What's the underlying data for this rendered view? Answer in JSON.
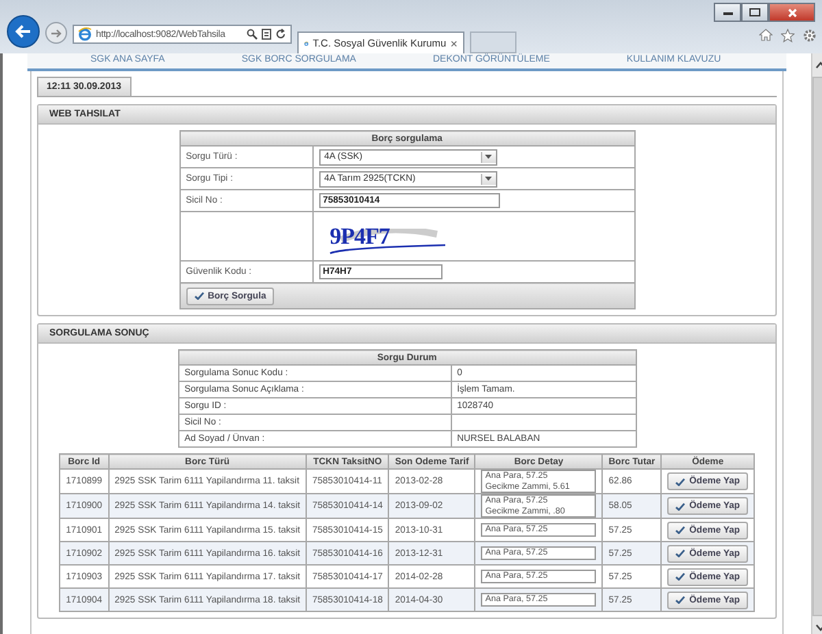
{
  "browser": {
    "address": "http://localhost:9082/WebTahsila",
    "tab_title": "T.C. Sosyal Güvenlik Kurumu",
    "tab_close": "×"
  },
  "nav": [
    "SGK ANA SAYFA",
    "SGK BORC SORGULAMA",
    "DEKONT GÖRÜNTÜLEME",
    "KULLANIM KLAVUZU"
  ],
  "datetime": "12:11 30.09.2013",
  "web_tahsilat": {
    "title": "WEB TAHSILAT",
    "form_title": "Borç sorgulama",
    "button": "Borç Sorgula",
    "fields": [
      {
        "kind": "select",
        "label": "Sorgu Türü :",
        "value": "4A (SSK)"
      },
      {
        "kind": "select",
        "label": "Sorgu Tipi :",
        "value": "4A Tarım 2925(TCKN)"
      },
      {
        "kind": "input",
        "label": "Sicil No :",
        "value": "75853010414"
      },
      {
        "kind": "captcha",
        "captcha_text": "9P4F7"
      },
      {
        "kind": "input",
        "label": "Güvenlik Kodu :",
        "value": "H74H7"
      }
    ]
  },
  "result": {
    "title": "SORGULAMA SONUÇ",
    "status_title": "Sorgu Durum",
    "status": [
      {
        "label": "Sorgulama Sonuc Kodu :",
        "value": "0"
      },
      {
        "label": "Sorgulama Sonuc Açıklama :",
        "value": "İşlem Tamam."
      },
      {
        "label": "Sorgu ID :",
        "value": "1028740"
      },
      {
        "label": "Sicil No :"
      },
      {
        "label": "Ad Soyad / Ünvan :",
        "value": "NURSEL BALABAN"
      }
    ],
    "table": {
      "columns": [
        "Borc Id",
        "Borc Türü",
        "TCKN TaksitNO",
        "Son Odeme Tarif",
        "Borc Detay",
        "Borc Tutar",
        "Ödeme"
      ],
      "rows": [
        {
          "id": "1710899",
          "type": "2925 SSK Tarim 6111 Yapilandırma 11. taksit",
          "tckn": "75853010414-11",
          "due": "2013-02-28",
          "detail": [
            "Ana Para, 57.25",
            "Gecikme Zammi, 5.61"
          ],
          "amount": "62.86",
          "button": "Ödeme Yap"
        },
        {
          "id": "1710900",
          "type": "2925 SSK Tarim 6111 Yapilandırma 14. taksit",
          "tckn": "75853010414-14",
          "due": "2013-09-02",
          "detail": [
            "Ana Para, 57.25",
            "Gecikme Zammi, .80"
          ],
          "amount": "58.05",
          "button": "Ödeme Yap"
        },
        {
          "id": "1710901",
          "type": "2925 SSK Tarim 6111 Yapilandırma 15. taksit",
          "tckn": "75853010414-15",
          "due": "2013-10-31",
          "detail": [
            "Ana Para, 57.25"
          ],
          "amount": "57.25",
          "button": "Ödeme Yap"
        },
        {
          "id": "1710902",
          "type": "2925 SSK Tarim 6111 Yapilandırma 16. taksit",
          "tckn": "75853010414-16",
          "due": "2013-12-31",
          "detail": [
            "Ana Para, 57.25"
          ],
          "amount": "57.25",
          "button": "Ödeme Yap"
        },
        {
          "id": "1710903",
          "type": "2925 SSK Tarim 6111 Yapilandırma 17. taksit",
          "tckn": "75853010414-17",
          "due": "2014-02-28",
          "detail": [
            "Ana Para, 57.25"
          ],
          "amount": "57.25",
          "button": "Ödeme Yap"
        },
        {
          "id": "1710904",
          "type": "2925 SSK Tarim 6111 Yapilandırma 18. taksit",
          "tckn": "75853010414-18",
          "due": "2014-04-30",
          "detail": [
            "Ana Para, 57.25"
          ],
          "amount": "57.25",
          "button": "Ödeme Yap"
        }
      ]
    }
  }
}
